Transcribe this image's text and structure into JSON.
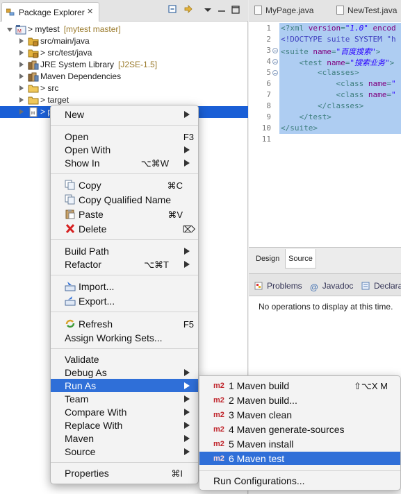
{
  "package_explorer": {
    "tab_label": "Package Explorer",
    "tab_close": "✕",
    "tree": [
      {
        "label": "> mytest",
        "decoration": "[mytest master]",
        "indent": 0,
        "open": true
      },
      {
        "label": "src/main/java",
        "decoration": "",
        "indent": 1,
        "open": false
      },
      {
        "label": "> src/test/java",
        "decoration": "",
        "indent": 1,
        "open": false
      },
      {
        "label": "JRE System Library",
        "decoration": "[J2SE-1.5]",
        "indent": 1,
        "open": false
      },
      {
        "label": "Maven Dependencies",
        "decoration": "",
        "indent": 1,
        "open": false
      },
      {
        "label": "> src",
        "decoration": "",
        "indent": 1,
        "open": false
      },
      {
        "label": "> target",
        "decoration": "",
        "indent": 1,
        "open": false
      },
      {
        "label": "> p",
        "decoration": "",
        "indent": 1,
        "open": false,
        "selected": true
      }
    ]
  },
  "editor": {
    "tabs": [
      "MyPage.java",
      "NewTest.java"
    ],
    "line_numbers": [
      "1",
      "2",
      "3",
      "4",
      "5",
      "6",
      "7",
      "8",
      "9",
      "10",
      "11"
    ],
    "bottom_tabs": [
      "Design",
      "Source"
    ],
    "active_bottom_tab": "Source"
  },
  "problems": {
    "tabs": [
      "Problems",
      "Javadoc",
      "Declara"
    ],
    "message": "No operations to display at this time."
  },
  "context_menu": {
    "new": "New",
    "open": "Open",
    "open_key": "F3",
    "open_with": "Open With",
    "show_in": "Show In",
    "show_in_key": "⌥⌘W",
    "copy": "Copy",
    "copy_key": "⌘C",
    "copy_qualified": "Copy Qualified Name",
    "paste": "Paste",
    "paste_key": "⌘V",
    "delete": "Delete",
    "delete_key": "⌦",
    "build_path": "Build Path",
    "refactor": "Refactor",
    "refactor_key": "⌥⌘T",
    "import": "Import...",
    "export": "Export...",
    "refresh": "Refresh",
    "refresh_key": "F5",
    "assign_sets": "Assign Working Sets...",
    "validate": "Validate",
    "debug_as": "Debug As",
    "run_as": "Run As",
    "team": "Team",
    "compare_with": "Compare With",
    "replace_with": "Replace With",
    "maven": "Maven",
    "source": "Source",
    "properties": "Properties",
    "properties_key": "⌘I"
  },
  "run_as_menu": {
    "badge": "m2",
    "items": [
      {
        "label": "1 Maven build",
        "key": "⇧⌥X M"
      },
      {
        "label": "2 Maven build...",
        "key": ""
      },
      {
        "label": "3 Maven clean",
        "key": ""
      },
      {
        "label": "4 Maven generate-sources",
        "key": ""
      },
      {
        "label": "5 Maven install",
        "key": ""
      },
      {
        "label": "6 Maven test",
        "key": ""
      }
    ],
    "run_configurations": "Run Configurations..."
  },
  "colors": {
    "selection": "#1a5fd6",
    "menu_highlight": "#2f6fd8",
    "code_selection": "#aecdf2",
    "m2_badge": "#c0262d"
  }
}
